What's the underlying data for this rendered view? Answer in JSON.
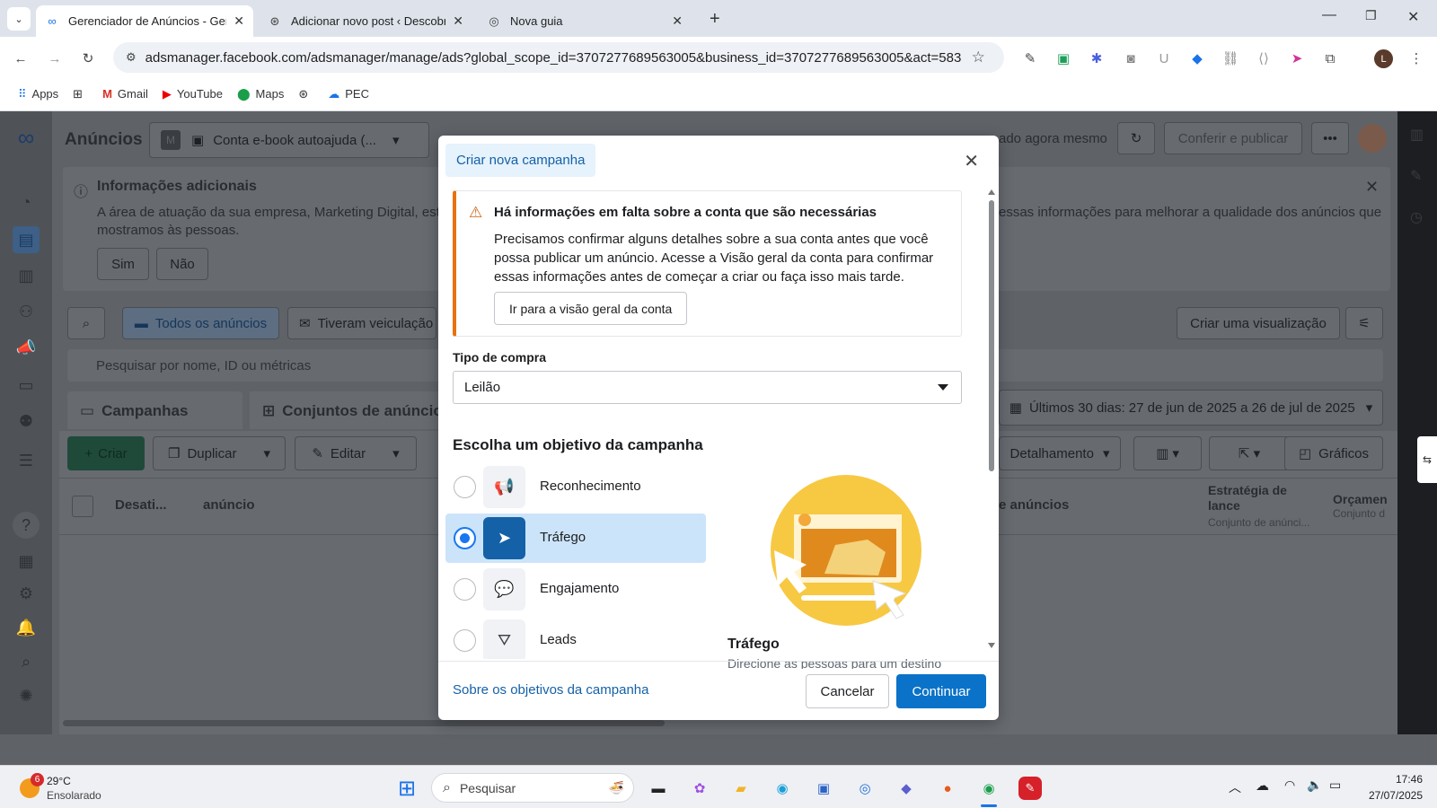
{
  "browser": {
    "tabs": [
      {
        "title": "Gerenciador de Anúncios - Gerc",
        "icon": "meta-icon"
      },
      {
        "title": "Adicionar novo post ‹ Descobri",
        "icon": "wordpress-icon"
      },
      {
        "title": "Nova guia",
        "icon": "chrome-icon"
      }
    ],
    "url": "adsmanager.facebook.com/adsmanager/manage/ads?global_scope_id=3707277689563005&business_id=3707277689563005&act=583030...",
    "bookmarks": [
      "Apps",
      "Gmail",
      "YouTube",
      "Maps",
      "PEC"
    ],
    "profile_initial": "L"
  },
  "page": {
    "header_title": "Anúncios",
    "account_badge": "M",
    "account_name": "Conta e-book autoajuda (...",
    "updated_text": "ado agora mesmo",
    "review_publish": "Conferir e publicar",
    "info_title": "Informações adicionais",
    "info_text_1": "A área de atuação da sua empresa, Marketing Digital, esta",
    "info_text_2": "mostramos às pessoas.",
    "info_text_right": "essas informações para melhorar a qualidade dos anúncios que",
    "yes": "Sim",
    "no": "Não",
    "all_ads": "Todos os anúncios",
    "delivered": "Tiveram veiculação",
    "create_view": "Criar uma visualização",
    "search_placeholder": "Pesquisar por nome, ID ou métricas",
    "tab_campaigns": "Campanhas",
    "tab_adsets": "Conjuntos de anúncio",
    "date_range": "Últimos 30 dias: 27 de jun de 2025 a 26 de jul de 2025",
    "create": "Criar",
    "duplicate": "Duplicar",
    "edit": "Editar",
    "breakdown": "Detalhamento",
    "charts": "Gráficos",
    "col_off": "Desati...",
    "col_ad": "anúncio",
    "col_ads": "e anúncios",
    "col_bid": "Estratégia de lance",
    "col_bid_sub": "Conjunto de anúnci...",
    "col_budget": "Orçamen",
    "col_budget_sub": "Conjunto d"
  },
  "modal": {
    "title": "Criar nova campanha",
    "warning_title": "Há informações em falta sobre a conta que são necessárias",
    "warning_body": "Precisamos confirmar alguns detalhes sobre a sua conta antes que você possa publicar um anúncio. Acesse a Visão geral da conta para confirmar essas informações antes de começar a criar ou faça isso mais tarde.",
    "warning_button": "Ir para a visão geral da conta",
    "buy_type_label": "Tipo de compra",
    "buy_type_value": "Leilão",
    "objective_heading": "Escolha um objetivo da campanha",
    "objectives": [
      {
        "label": "Reconhecimento",
        "icon": "megaphone-icon",
        "selected": false
      },
      {
        "label": "Tráfego",
        "icon": "cursor-icon",
        "selected": true
      },
      {
        "label": "Engajamento",
        "icon": "chat-bubbles-icon",
        "selected": false
      },
      {
        "label": "Leads",
        "icon": "funnel-icon",
        "selected": false
      }
    ],
    "detail_title": "Tráfego",
    "detail_desc": "Direcione as pessoas para um destino",
    "about_link": "Sobre os objetivos da campanha",
    "cancel": "Cancelar",
    "continue": "Continuar"
  },
  "taskbar": {
    "weather_temp": "29°C",
    "weather_desc": "Ensolarado",
    "weather_badge": "6",
    "search": "Pesquisar",
    "time": "17:46",
    "date": "27/07/2025"
  },
  "colors": {
    "accent": "#0a72c8",
    "selected_bg": "#cce4f9",
    "warning": "#e9710f"
  }
}
